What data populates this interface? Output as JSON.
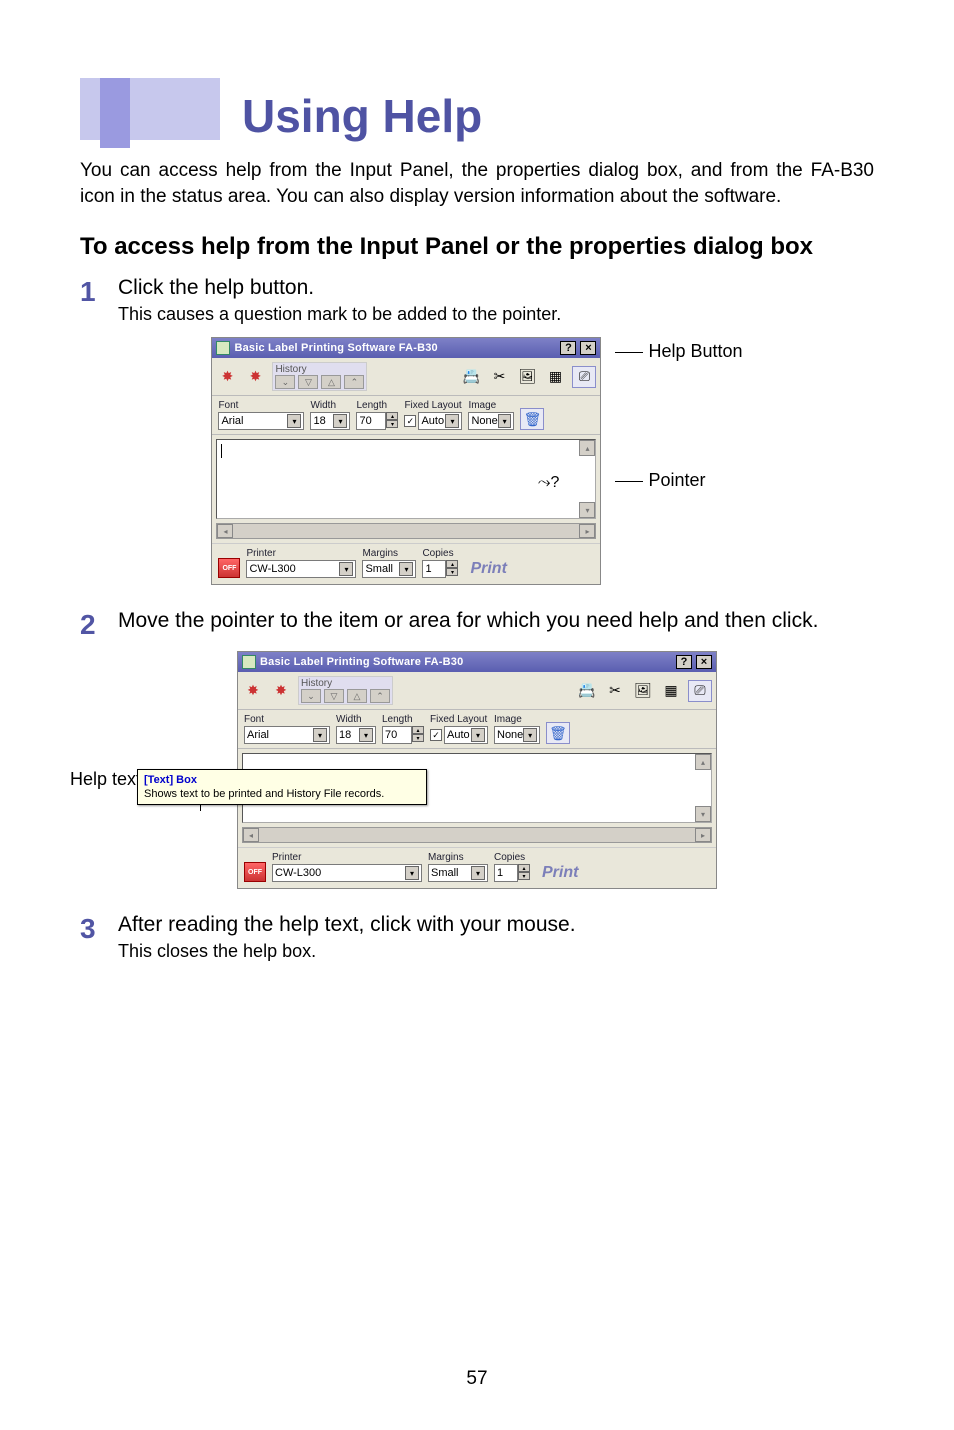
{
  "pageNumber": "57",
  "title": "Using Help",
  "intro": "You can access help from the Input Panel, the properties dialog box, and from the FA-B30 icon in the status area. You can also display version information about the software.",
  "sectionHeading": "To access help from the Input Panel or the properties dialog box",
  "steps": {
    "s1": {
      "num": "1",
      "line1": "Click the help button.",
      "line2": "This causes a question mark to be added to the pointer."
    },
    "s2": {
      "num": "2",
      "line1": "Move the pointer to the item or area for which you need help and then click."
    },
    "s3": {
      "num": "3",
      "line1": "After reading the help text, click with your mouse.",
      "line2": "This closes the help box."
    }
  },
  "callouts": {
    "helpButton": "Help Button",
    "pointer": "Pointer",
    "helpText": "Help text"
  },
  "window": {
    "title": "Basic Label Printing Software FA-B30",
    "helpBtn": "?",
    "closeBtn": "×",
    "history": "History",
    "labels": {
      "font": "Font",
      "width": "Width",
      "length": "Length",
      "fixed": "Fixed Layout",
      "image": "Image",
      "printer": "Printer",
      "margins": "Margins",
      "copies": "Copies"
    },
    "values": {
      "font": "Arial",
      "width": "18",
      "length": "70",
      "layout": "Auto",
      "image": "None",
      "printer": "CW-L300",
      "margins": "Small",
      "copies": "1"
    },
    "offLabel": "OFF",
    "printBtn": "Print",
    "checkboxChecked": "✓"
  },
  "tooltip": {
    "title": "[Text] Box",
    "body": "Shows text to be printed and History File records."
  }
}
